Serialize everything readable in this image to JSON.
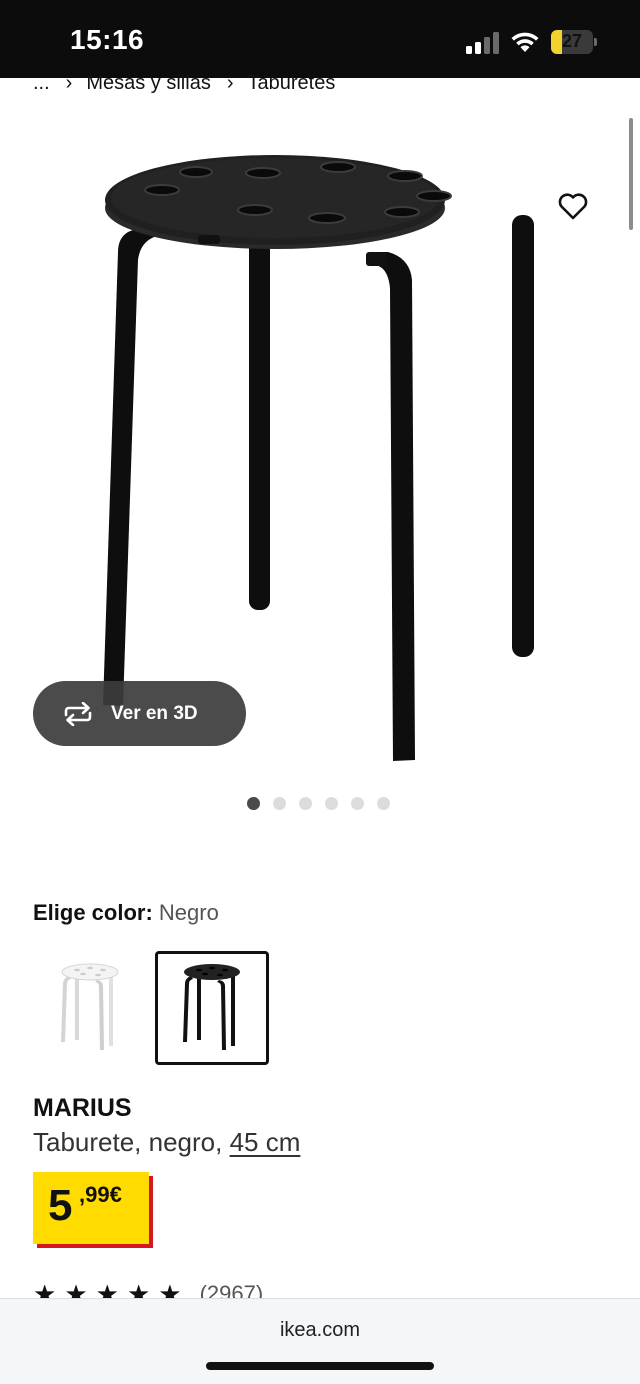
{
  "status_bar": {
    "time": "15:16",
    "battery_level": "27",
    "battery_fraction": 0.27,
    "battery_color": "#f2d22c"
  },
  "breadcrumb": {
    "ellipsis": "...",
    "items": [
      "Mesas y sillas",
      "Taburetes"
    ]
  },
  "gallery": {
    "view_3d_label": "Ver en 3D",
    "dot_count": 6,
    "active_dot": 0,
    "favorite_icon": "heart-icon"
  },
  "color": {
    "label": "Elige color:",
    "selected": "Negro",
    "options": [
      "white",
      "black"
    ]
  },
  "product": {
    "name": "MARIUS",
    "description": "Taburete, negro, ",
    "size_link": "45 cm",
    "price_integer": "5",
    "price_decimal": ",99€",
    "price_bg": "#ffdb00",
    "price_shadow": "#d4181c",
    "rating_count": "(2967)"
  },
  "browser": {
    "url": "ikea.com"
  }
}
